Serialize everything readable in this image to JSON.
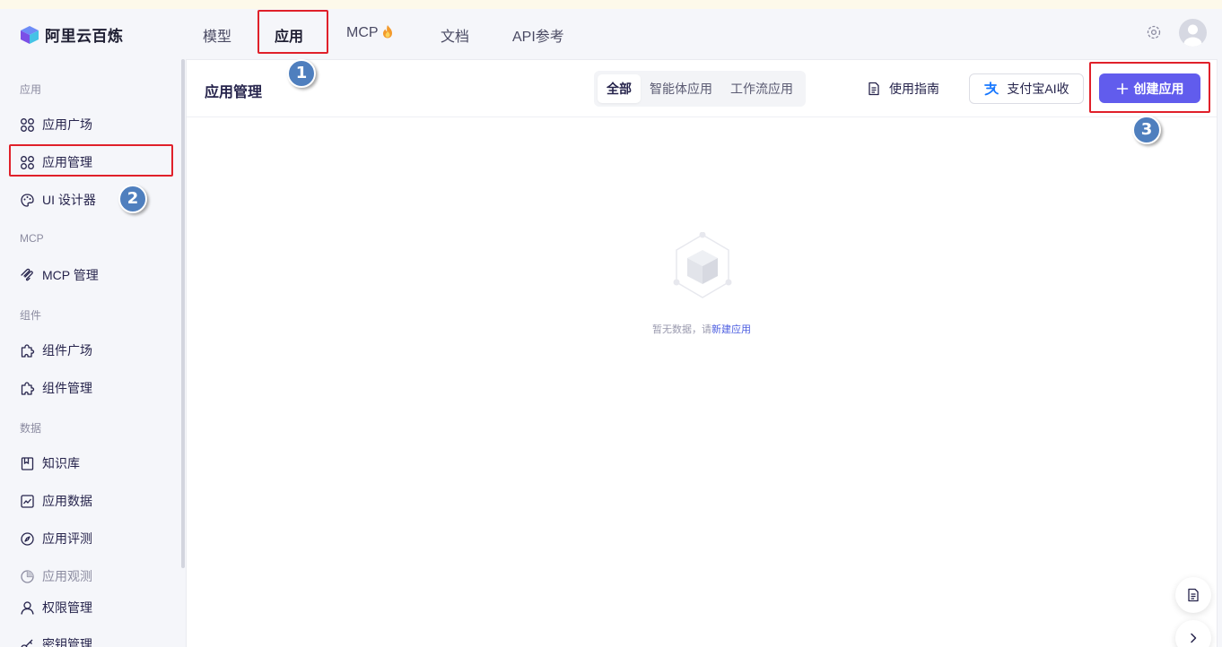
{
  "app": {
    "name": "阿里云百炼"
  },
  "topnav": {
    "items": [
      {
        "label": "模型"
      },
      {
        "label": "应用",
        "active": true
      },
      {
        "label": "MCP"
      },
      {
        "label": "文档"
      },
      {
        "label": "API参考"
      }
    ],
    "icons": {
      "mcp_badge": "fire-icon",
      "settings": "gear-icon",
      "user": "avatar-icon"
    }
  },
  "sidebar": {
    "groups": [
      {
        "label": "应用"
      },
      {
        "label": "MCP"
      },
      {
        "label": "组件"
      },
      {
        "label": "数据"
      }
    ],
    "items": [
      {
        "label": "应用广场",
        "icon": "apps-grid-icon"
      },
      {
        "label": "应用管理",
        "icon": "apps-grid-icon",
        "selected": true
      },
      {
        "label": "UI 设计器",
        "icon": "palette-icon"
      },
      {
        "label": "MCP 管理",
        "icon": "mcp-icon"
      },
      {
        "label": "组件广场",
        "icon": "puzzle-icon"
      },
      {
        "label": "组件管理",
        "icon": "puzzle-icon"
      },
      {
        "label": "知识库",
        "icon": "book-icon"
      },
      {
        "label": "应用数据",
        "icon": "chart-icon"
      },
      {
        "label": "应用评测",
        "icon": "compass-icon"
      },
      {
        "label": "应用观测",
        "icon": "pie-icon",
        "disabled": true
      },
      {
        "label": "权限管理",
        "icon": "user-icon"
      },
      {
        "label": "密钥管理",
        "icon": "key-icon"
      }
    ]
  },
  "main": {
    "title": "应用管理",
    "tabs": [
      {
        "label": "全部",
        "active": true
      },
      {
        "label": "智能体应用"
      },
      {
        "label": "工作流应用"
      }
    ],
    "guide_label": "使用指南",
    "alipay_label": "支付宝AI收",
    "create_label": "创建应用",
    "empty": {
      "text": "暂无数据，请",
      "link": "新建应用"
    }
  },
  "annotations": {
    "steps": [
      "1",
      "2",
      "3"
    ],
    "highlight_color": "#e0202a",
    "badge_color": "#4f7fbe"
  },
  "colors": {
    "accent": "#615ced",
    "link": "#4b5ce0"
  }
}
